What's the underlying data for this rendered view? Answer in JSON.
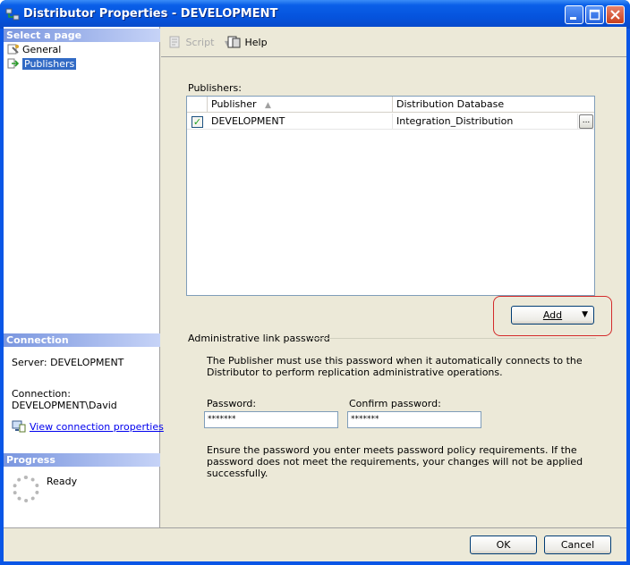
{
  "window": {
    "title": "Distributor Properties - DEVELOPMENT"
  },
  "left": {
    "select_page_header": "Select a page",
    "pages": [
      {
        "label": "General",
        "icon": "wrench-page-icon"
      },
      {
        "label": "Publishers",
        "icon": "publisher-arrow-icon",
        "selected": true
      }
    ],
    "connection_header": "Connection",
    "server_label": "Server: DEVELOPMENT",
    "connection_label": "Connection:",
    "connection_value": "DEVELOPMENT\\David",
    "view_connection_link": "View connection properties",
    "progress_header": "Progress",
    "progress_status": "Ready"
  },
  "toolbar": {
    "script_label": "Script",
    "help_label": "Help"
  },
  "publishers": {
    "section_label": "Publishers:",
    "columns": [
      "Publisher",
      "Distribution Database"
    ],
    "rows": [
      {
        "checked": true,
        "publisher": "DEVELOPMENT",
        "distribution_db": "Integration_Distribution",
        "ellipsis": "..."
      }
    ],
    "add_button": "Add"
  },
  "admin_link": {
    "group_label": "Administrative link password",
    "description": "The Publisher must use this password when it automatically connects to the Distributor to perform replication administrative operations.",
    "password_label": "Password:",
    "password_value": "*******",
    "confirm_label": "Confirm password:",
    "confirm_value": "*******",
    "policy_note": "Ensure the password you enter meets password policy requirements. If the password does not meet the requirements, your changes will not be applied successfully."
  },
  "footer": {
    "ok_label": "OK",
    "cancel_label": "Cancel"
  },
  "colors": {
    "titlebar": "#0553dd",
    "selection": "#316ac5",
    "highlight_ring": "#d42b2b"
  }
}
